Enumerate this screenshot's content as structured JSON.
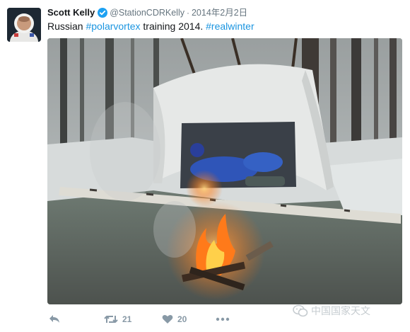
{
  "tweet": {
    "author_name": "Scott Kelly",
    "handle": "@StationCDRKelly",
    "separator": "·",
    "date": "2014年2月2日",
    "text_plain_1": "Russian ",
    "hashtag_1": "#polarvortex",
    "text_plain_2": " training 2014. ",
    "hashtag_2": "#realwinter",
    "retweet_count": "21",
    "like_count": "20"
  },
  "watermark": {
    "text": "中国国家天文"
  },
  "icons": {
    "verified": "verified-badge-icon",
    "reply": "reply-icon",
    "retweet": "retweet-icon",
    "like": "heart-icon",
    "more": "more-dots-icon",
    "watermark": "wechat-icon"
  },
  "colors": {
    "link": "#1b95e0",
    "verified": "#1da1f2",
    "action": "#8899a6"
  }
}
